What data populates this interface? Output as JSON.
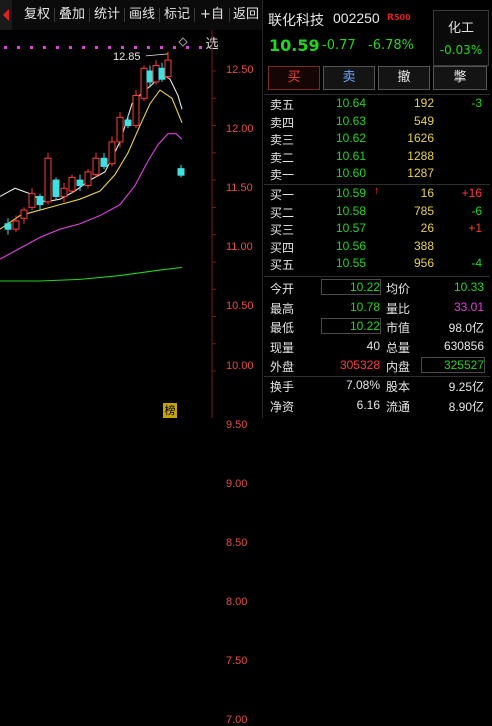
{
  "toolbar": {
    "items": [
      "复权",
      "叠加",
      "统计",
      "画线",
      "标记",
      "+自选",
      "返回"
    ]
  },
  "chart_data": {
    "type": "candlestick",
    "y_ticks": [
      "12.50",
      "12.00",
      "11.50",
      "11.00",
      "10.50",
      "10.00",
      "9.50",
      "9.00",
      "8.50",
      "8.00",
      "7.50",
      "7.00"
    ],
    "annotation": "12.85",
    "colors": {
      "up": "#ff3b3b",
      "down": "#3fe0e0",
      "ma5": "#e8e8e8",
      "ma10": "#e8d24a",
      "ma20": "#e040e0",
      "ma60": "#1fd61f",
      "axis_text": "#e84a4a"
    }
  },
  "quote": {
    "name": "联化科技",
    "code": "002250",
    "badge_r": "R",
    "badge_num": "500",
    "price": "10.59",
    "change": "-0.77",
    "change_pct": "-6.78%"
  },
  "sector": {
    "name": "化工",
    "pct": "-0.03%"
  },
  "actions": [
    "买",
    "卖",
    "撤",
    "撆"
  ],
  "sell_orders": [
    {
      "label": "卖五",
      "price": "10.64",
      "vol": "192",
      "delta": "-3",
      "delta_color": "green"
    },
    {
      "label": "卖四",
      "price": "10.63",
      "vol": "549",
      "delta": "",
      "delta_color": "green"
    },
    {
      "label": "卖三",
      "price": "10.62",
      "vol": "1626",
      "delta": "",
      "delta_color": "green"
    },
    {
      "label": "卖二",
      "price": "10.61",
      "vol": "1288",
      "delta": "",
      "delta_color": "green"
    },
    {
      "label": "卖一",
      "price": "10.60",
      "vol": "1287",
      "delta": "",
      "delta_color": "green"
    }
  ],
  "buy_orders": [
    {
      "label": "买一",
      "price": "10.59",
      "arrow": "↑",
      "vol": "16",
      "delta": "+16",
      "delta_color": "red"
    },
    {
      "label": "买二",
      "price": "10.58",
      "arrow": "",
      "vol": "785",
      "delta": "-6",
      "delta_color": "green"
    },
    {
      "label": "买三",
      "price": "10.57",
      "arrow": "",
      "vol": "26",
      "delta": "+1",
      "delta_color": "red"
    },
    {
      "label": "买四",
      "price": "10.56",
      "arrow": "",
      "vol": "388",
      "delta": "",
      "delta_color": "green"
    },
    {
      "label": "买五",
      "price": "10.55",
      "arrow": "",
      "vol": "956",
      "delta": "-4",
      "delta_color": "green"
    }
  ],
  "stats": [
    {
      "l1": "今开",
      "v1": "10.22",
      "c1": "g",
      "b1": true,
      "l2": "均价",
      "v2": "10.33",
      "c2": "g",
      "b2": false
    },
    {
      "l1": "最高",
      "v1": "10.78",
      "c1": "g",
      "b1": false,
      "l2": "量比",
      "v2": "33.01",
      "c2": "m",
      "b2": false
    },
    {
      "l1": "最低",
      "v1": "10.22",
      "c1": "g",
      "b1": true,
      "l2": "市值",
      "v2": "98.0亿",
      "c2": "w",
      "b2": false
    },
    {
      "l1": "现量",
      "v1": "40",
      "c1": "w",
      "b1": false,
      "l2": "总量",
      "v2": "630856",
      "c2": "w",
      "b2": false
    },
    {
      "l1": "外盘",
      "v1": "305328",
      "c1": "r",
      "b1": false,
      "l2": "内盘",
      "v2": "325527",
      "c2": "g",
      "b2": true
    },
    {
      "l1": "换手",
      "v1": "7.08%",
      "c1": "w",
      "b1": false,
      "l2": "股本",
      "v2": "9.25亿",
      "c2": "w",
      "b2": false
    },
    {
      "l1": "净资",
      "v1": "6.16",
      "c1": "w",
      "b1": false,
      "l2": "流通",
      "v2": "8.90亿",
      "c2": "w",
      "b2": false
    }
  ],
  "bottom_tag": "榜"
}
